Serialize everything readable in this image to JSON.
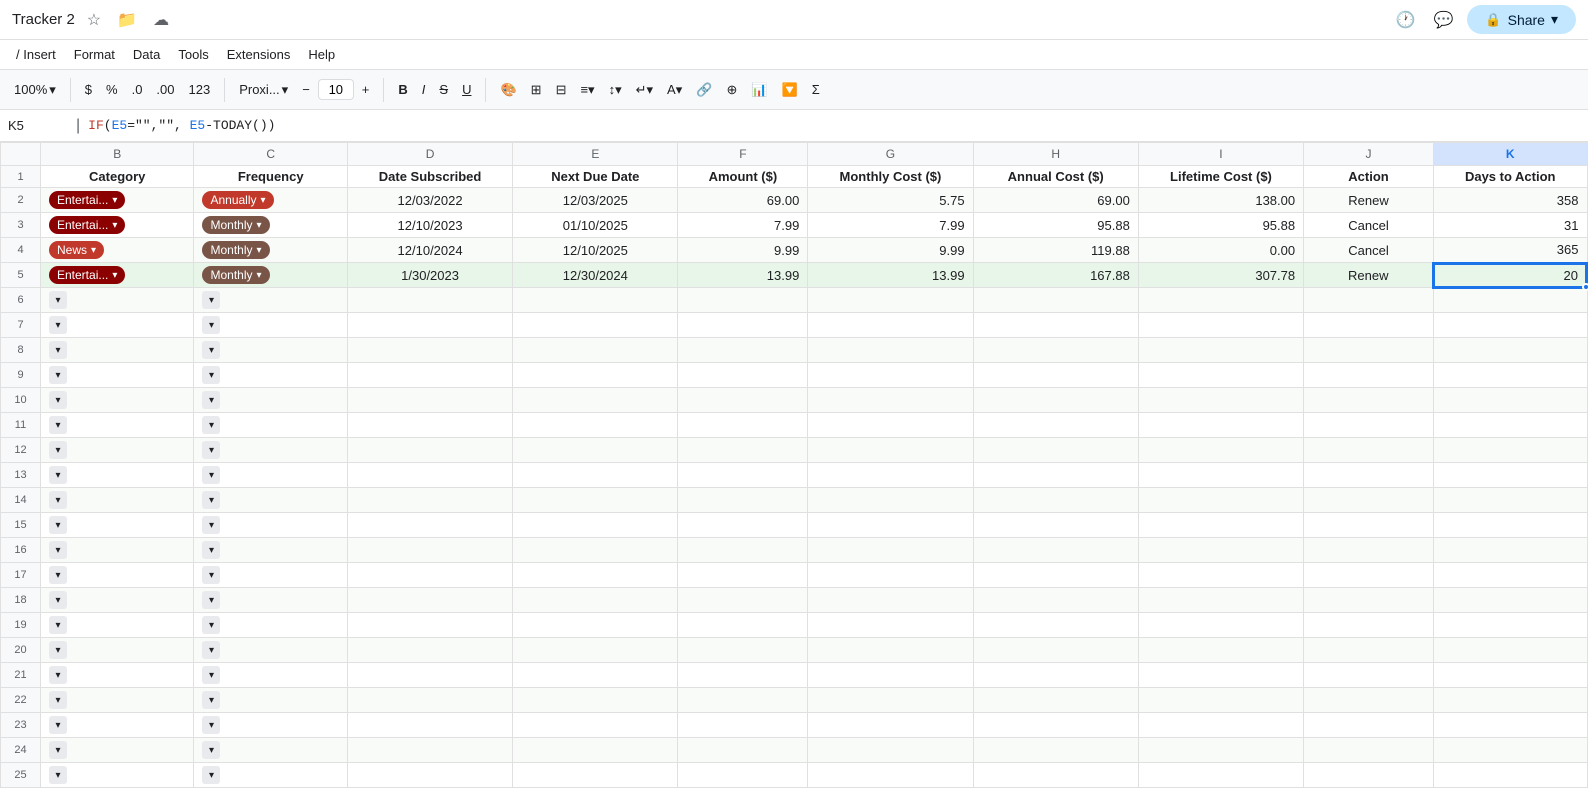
{
  "app": {
    "title": "Tracker 2",
    "formula_bar": {
      "cell_ref": "K5",
      "formula": "IF(E5=\"\",\"\", E5-TODAY())"
    }
  },
  "menu": {
    "items": [
      "/ Insert",
      "Format",
      "Data",
      "Tools",
      "Extensions",
      "Help"
    ]
  },
  "toolbar": {
    "zoom": "100%",
    "currency_symbol": "$",
    "percent": "%",
    "decimal_less": ".0",
    "decimal_more": ".00",
    "format_123": "123",
    "font": "Proxi...",
    "font_size": "10",
    "bold": "B",
    "italic": "I",
    "strikethrough": "S̶",
    "underline": "U"
  },
  "columns": {
    "headers": [
      "",
      "B",
      "C",
      "D",
      "E",
      "F",
      "G",
      "H",
      "I",
      "J",
      "K"
    ],
    "widths": [
      40,
      130,
      130,
      140,
      140,
      110,
      140,
      140,
      140,
      110,
      130
    ]
  },
  "header_row": {
    "cells": [
      "",
      "Category",
      "Frequency",
      "Date Subscribed",
      "Next Due Date",
      "Amount ($)",
      "Monthly Cost ($)",
      "Annual Cost ($)",
      "Lifetime Cost ($)",
      "Action",
      "Days to Action"
    ]
  },
  "data_rows": [
    {
      "id": 1,
      "category": "Entertai...",
      "category_type": "entertainment",
      "frequency": "Annually",
      "frequency_type": "annually",
      "date_subscribed": "12/03/2022",
      "next_due_date": "12/03/2025",
      "amount": "69.00",
      "monthly_cost": "5.75",
      "annual_cost": "69.00",
      "lifetime_cost": "138.00",
      "action": "Renew",
      "days_to_action": "358",
      "green": false
    },
    {
      "id": 2,
      "category": "Entertai...",
      "category_type": "entertainment",
      "frequency": "Monthly",
      "frequency_type": "monthly",
      "date_subscribed": "12/10/2023",
      "next_due_date": "01/10/2025",
      "amount": "7.99",
      "monthly_cost": "7.99",
      "annual_cost": "95.88",
      "lifetime_cost": "95.88",
      "action": "Cancel",
      "days_to_action": "31",
      "green": false
    },
    {
      "id": 3,
      "category": "News",
      "category_type": "news",
      "frequency": "Monthly",
      "frequency_type": "monthly",
      "date_subscribed": "12/10/2024",
      "next_due_date": "12/10/2025",
      "amount": "9.99",
      "monthly_cost": "9.99",
      "annual_cost": "119.88",
      "lifetime_cost": "0.00",
      "action": "Cancel",
      "days_to_action": "365",
      "green": false
    },
    {
      "id": 4,
      "category": "Entertai...",
      "category_type": "entertainment",
      "frequency": "Monthly",
      "frequency_type": "monthly",
      "date_subscribed": "1/30/2023",
      "next_due_date": "12/30/2024",
      "amount": "13.99",
      "monthly_cost": "13.99",
      "annual_cost": "167.88",
      "lifetime_cost": "307.78",
      "action": "Renew",
      "days_to_action": "20",
      "green": true
    }
  ],
  "empty_rows": 20,
  "colors": {
    "entertainment_pill": "#8B0000",
    "news_pill": "#c0392b",
    "monthly_pill": "#795548",
    "annually_pill": "#c0392b",
    "selected_col": "#d3e3fd",
    "green_row": "#e8f5e9",
    "active_border": "#1a73e8"
  }
}
